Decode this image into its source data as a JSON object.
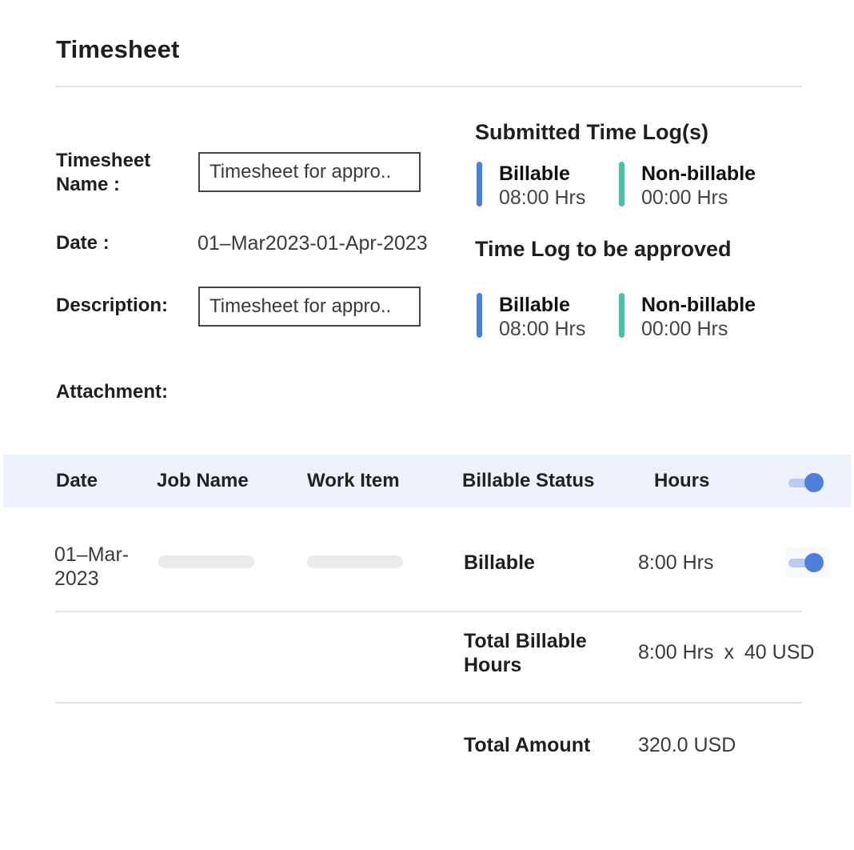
{
  "page": {
    "title": "Timesheet"
  },
  "form": {
    "name_label_line1": "Timesheet",
    "name_label_line2": "Name :",
    "name_value": "Timesheet for appro..",
    "date_label": "Date :",
    "date_value": "01–Mar2023-01-Apr-2023",
    "description_label": "Description:",
    "description_value": "Timesheet for appro..",
    "attachment_label": "Attachment:"
  },
  "summary": {
    "submitted": {
      "title": "Submitted Time Log(s)",
      "billable_label": "Billable",
      "billable_value": "08:00 Hrs",
      "nonbillable_label": "Non-billable",
      "nonbillable_value": "00:00 Hrs"
    },
    "to_approve": {
      "title": "Time Log to be approved",
      "billable_label": "Billable",
      "billable_value": "08:00 Hrs",
      "nonbillable_label": "Non-billable",
      "nonbillable_value": "00:00 Hrs"
    },
    "colors": {
      "billable": "#4f80d9",
      "nonbillable": "#4fbf9f"
    }
  },
  "table": {
    "headers": {
      "date": "Date",
      "job_name": "Job Name",
      "work_item": "Work Item",
      "billable_status": "Billable Status",
      "hours": "Hours"
    },
    "rows": [
      {
        "date_line1": "01–Mar-",
        "date_line2": "2023",
        "billable_status": "Billable",
        "hours": "8:00 Hrs",
        "toggle_on": true
      }
    ],
    "header_toggle_on": true
  },
  "totals": {
    "billable_hours_label_line1": "Total Billable",
    "billable_hours_label_line2": "Hours",
    "billable_hours_value": "8:00 Hrs",
    "multiply_sign": "x",
    "rate": "40 USD",
    "amount_label": "Total Amount",
    "amount_value": "320.0 USD"
  }
}
